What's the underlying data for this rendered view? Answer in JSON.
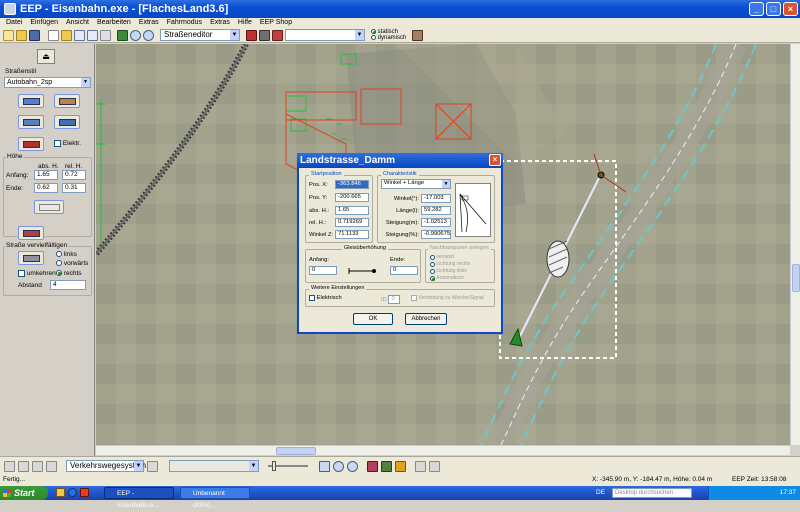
{
  "window": {
    "title": "EEP - Eisenbahn.exe - [FlachesLand3.6]",
    "buttons": [
      "_",
      "□",
      "×"
    ]
  },
  "menu": [
    "Datei",
    "Einfügen",
    "Ansicht",
    "Bearbeiten",
    "Extras",
    "Fahrmodus",
    "Extras",
    "Hilfe",
    "EEP Shop"
  ],
  "toolbar": {
    "editor_select": "Straßeneditor",
    "empty_select": "",
    "radio_static": "statisch",
    "radio_dynamic": "dynamisch"
  },
  "left_panel": {
    "stilart_label": "Straßenstil",
    "stilart_value": "Autobahn_2sp",
    "elektr_label": "Elektr.",
    "hoehe_label": "Höhe",
    "col_abs": "abs. H.",
    "col_rel": "rel. H.",
    "anfang_label": "Anfang:",
    "anfang_abs": "1.65",
    "anfang_rel": "0.72",
    "ende_label": "Ende:",
    "ende_abs": "0.62",
    "ende_rel": "0.31",
    "group_title": "Straße vervielfältigen",
    "links_label": "links",
    "vorwaerts_label": "vorwärts",
    "umkehren_label": "umkehren",
    "rechts_label": "rechts",
    "abstand_label": "Abstand",
    "abstand_value": "4"
  },
  "dialog": {
    "title": "Landstrasse_Damm",
    "startposition_legend": "Startposition",
    "pos_x_label": "Pos. X:",
    "pos_x_value": "-363.846",
    "pos_y_label": "Pos. Y:",
    "pos_y_value": "-200.665",
    "abs_h_label": "abs. H.:",
    "abs_h_value": "1.65",
    "rel_h_label": "rel. H.:",
    "rel_h_value": "0.719269",
    "winkel_z_label": "Winkel Z:",
    "winkel_z_value": "71.1133",
    "charakteristik_legend": "Charakteristik",
    "char_select": "Winkel + Länge",
    "winkel_label": "Winkel(°):",
    "winkel_value": "-17.003",
    "laenge_label": "Länge(l):",
    "laenge_value": "59.282",
    "steigung_m_label": "Steigung(m):",
    "steigung_m_value": "-1.02513",
    "steigung_pct_label": "Steigung(%):",
    "steigung_pct_value": "-0.990675",
    "glaettung_legend": "Gleisüberhöhung",
    "anfang_label": "Anfang:",
    "anfang_value": "0",
    "ende_label": "Ende:",
    "ende_value": "0",
    "nachfolger_legend": "Nachbarspuren anlegen",
    "nf_options": [
      "versetzt",
      "Lichtung rechts",
      "Lichtung links",
      "Automatisch"
    ],
    "weitere_legend": "Weitere Einstellungen",
    "elektrisch_label": "Elektrisch",
    "id_label": "ID",
    "id_value": "0",
    "verbindung_label": "Verbindung zu Weiche/Signal",
    "ok_label": "OK",
    "abbrechen_label": "Abbrechen"
  },
  "statusbar": {
    "select": "Verkehrswegesystem",
    "status_text": "Fertig...",
    "coords": "X: -345.90 m, Y: -184.47 m, Höhe: 0.04 m",
    "eep_time": "EEP Zeit: 13:58:08"
  },
  "taskbar": {
    "start": "Start",
    "tasks": [
      "EEP - Eisenbahn.e...",
      "Unbenannt (83%)..."
    ],
    "lang": "DE",
    "search_placeholder": "Desktop durchsuchen",
    "clock": "17:37"
  }
}
